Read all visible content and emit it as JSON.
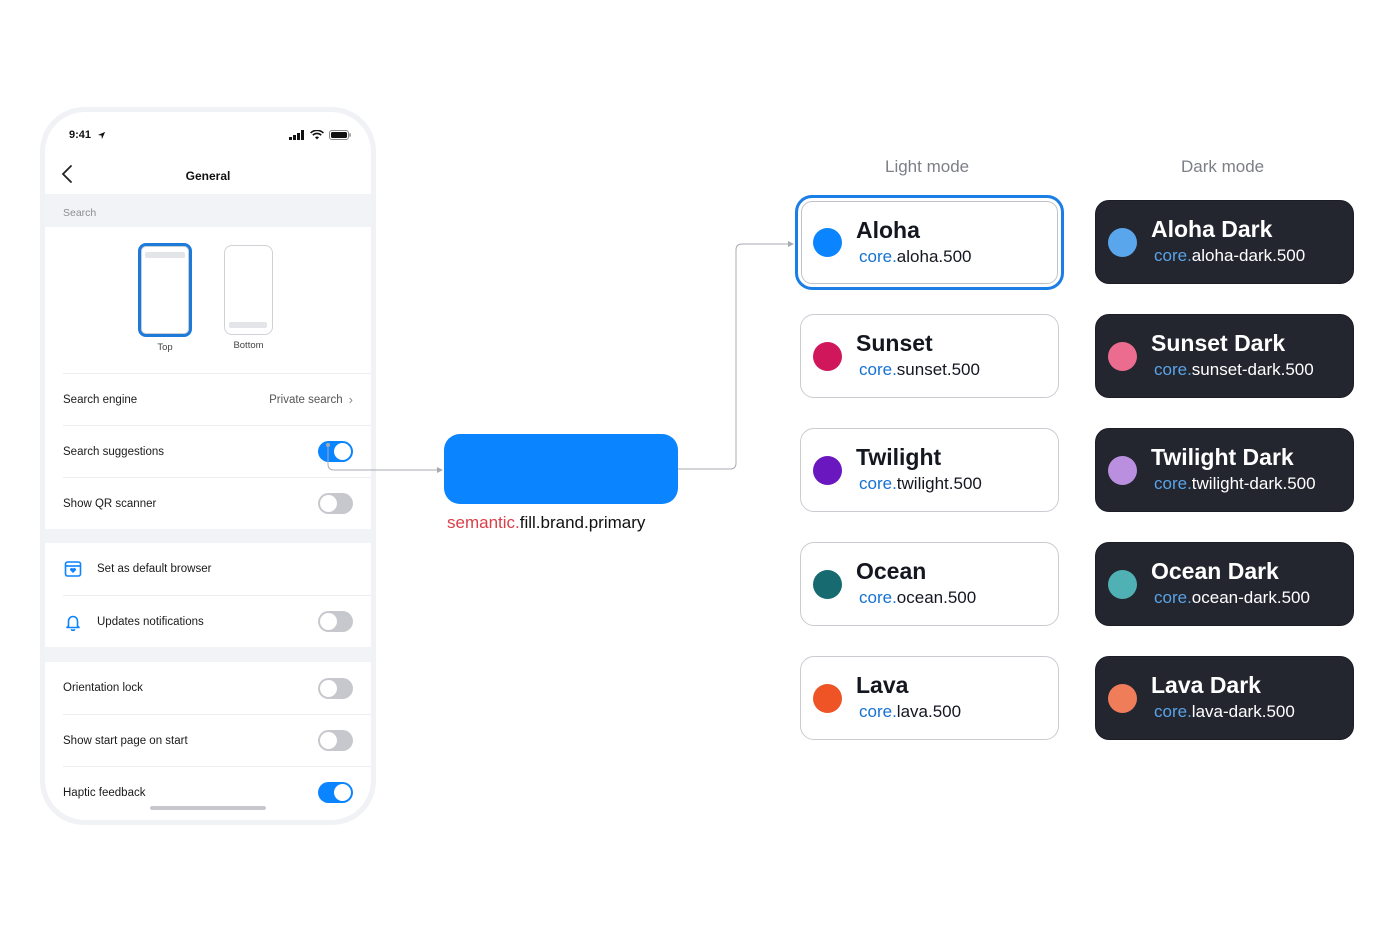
{
  "phone": {
    "status_bar": {
      "time": "9:41"
    },
    "nav": {
      "title": "General",
      "back_icon": "chevron-left-icon"
    },
    "section_label": "Search",
    "layout_options": [
      {
        "label": "Top",
        "selected": true
      },
      {
        "label": "Bottom",
        "selected": false
      }
    ],
    "rows_search": [
      {
        "label": "Search engine",
        "value": "Private search",
        "type": "link"
      },
      {
        "label": "Search suggestions",
        "type": "toggle",
        "on": true
      },
      {
        "label": "Show QR scanner",
        "type": "toggle",
        "on": false
      }
    ],
    "rows_browser": [
      {
        "label": "Set as default browser",
        "icon": "browser-heart-icon",
        "type": "action"
      },
      {
        "label": "Updates notifications",
        "icon": "bell-icon",
        "type": "toggle",
        "on": false
      }
    ],
    "rows_misc": [
      {
        "label": "Orientation lock",
        "type": "toggle",
        "on": false
      },
      {
        "label": "Show start page on start",
        "type": "toggle",
        "on": false
      },
      {
        "label": "Haptic feedback",
        "type": "toggle",
        "on": true
      }
    ]
  },
  "semantic_token": {
    "prefix": "semantic.",
    "name": "fill.brand.primary",
    "color": "#0a84ff",
    "prefix_color": "#d9404a"
  },
  "columns": {
    "light": "Light mode",
    "dark": "Dark mode"
  },
  "themes": [
    {
      "light": {
        "name": "Aloha",
        "prefix": "core.",
        "token": "aloha.500",
        "color": "#0a84ff",
        "selected": true
      },
      "dark": {
        "name": "Aloha Dark",
        "prefix": "core.",
        "token": "aloha-dark.500",
        "color": "#5aa6ec"
      }
    },
    {
      "light": {
        "name": "Sunset",
        "prefix": "core.",
        "token": "sunset.500",
        "color": "#d0175c"
      },
      "dark": {
        "name": "Sunset Dark",
        "prefix": "core.",
        "token": "sunset-dark.500",
        "color": "#ec6c90"
      }
    },
    {
      "light": {
        "name": "Twilight",
        "prefix": "core.",
        "token": "twilight.500",
        "color": "#6a17c0"
      },
      "dark": {
        "name": "Twilight Dark",
        "prefix": "core.",
        "token": "twilight-dark.500",
        "color": "#bb8fe0"
      }
    },
    {
      "light": {
        "name": "Ocean",
        "prefix": "core.",
        "token": "ocean.500",
        "color": "#166a70"
      },
      "dark": {
        "name": "Ocean Dark",
        "prefix": "core.",
        "token": "ocean-dark.500",
        "color": "#4fb1b4"
      }
    },
    {
      "light": {
        "name": "Lava",
        "prefix": "core.",
        "token": "lava.500",
        "color": "#ee5425"
      },
      "dark": {
        "name": "Lava Dark",
        "prefix": "core.",
        "token": "lava-dark.500",
        "color": "#f07d5a"
      }
    }
  ]
}
